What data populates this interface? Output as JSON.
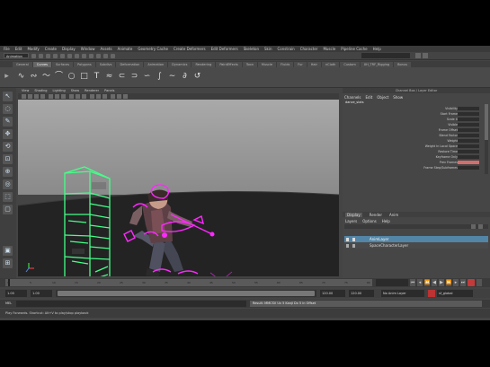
{
  "menubar": {
    "items": [
      "File",
      "Edit",
      "Modify",
      "Create",
      "Display",
      "Window",
      "Assets",
      "Animate",
      "Geometry Cache",
      "Create Deformers",
      "Edit Deformers",
      "Skeleton",
      "Skin",
      "Constrain",
      "Character",
      "Muscle",
      "Pipeline Cache",
      "Help"
    ]
  },
  "statusline": {
    "mode": "Animation"
  },
  "shelf": {
    "tabs": [
      "General",
      "Curves",
      "Surfaces",
      "Polygons",
      "Subdivs",
      "Deformation",
      "Animation",
      "Dynamics",
      "Rendering",
      "PaintEffects",
      "Toon",
      "Muscle",
      "Fluids",
      "Fur",
      "Hair",
      "nCloth",
      "Custom",
      "XH_TRF_Rigging",
      "Bonus"
    ],
    "active_tab": "Curves"
  },
  "viewport": {
    "menus": [
      "View",
      "Shading",
      "Lighting",
      "Show",
      "Renderer",
      "Panels"
    ]
  },
  "channelbox": {
    "title": "Channel Box / Layer Editor",
    "menus": [
      "Channels",
      "Edit",
      "Object",
      "Show"
    ],
    "object": "dance_slots",
    "attributes": [
      "Visibility",
      "Start Frame",
      "Scale X",
      "Visible",
      "Frame Offset",
      "Blend Factor",
      "Weight",
      "Weight In Local Space",
      "Restore Time",
      "Keyframe Only",
      "Prev Frames",
      "Frame Step/Subframes"
    ],
    "layer_tabs": [
      "Display",
      "Render",
      "Anim"
    ],
    "layer_menus": [
      "Layers",
      "Options",
      "Help"
    ],
    "layers": [
      "AnimLayer",
      "SpaceCharacterLayer"
    ]
  },
  "timeslider": {
    "ticks": [
      "1",
      "5",
      "10",
      "15",
      "20",
      "25",
      "30",
      "35",
      "40",
      "45",
      "50",
      "55",
      "60",
      "65",
      "70",
      "75",
      "80"
    ]
  },
  "rangeslider": {
    "start": "1.00",
    "current": "1.00",
    "end": "120.00",
    "end2": "120.00",
    "anim_layer": "No Anim Layer",
    "character": "sf_global"
  },
  "commandline": {
    "label": "MEL",
    "result": "Result: MMCSV  Uv 5 Kanji Dx 5 in Offset"
  },
  "helpline": {
    "text": "Play Forwards. Shortcut: Alt+V to play/stop playback"
  },
  "colors": {
    "background": "#444444",
    "highlight": "#5285a6",
    "selected": "#44ff88",
    "magenta": "#ff28ff"
  }
}
